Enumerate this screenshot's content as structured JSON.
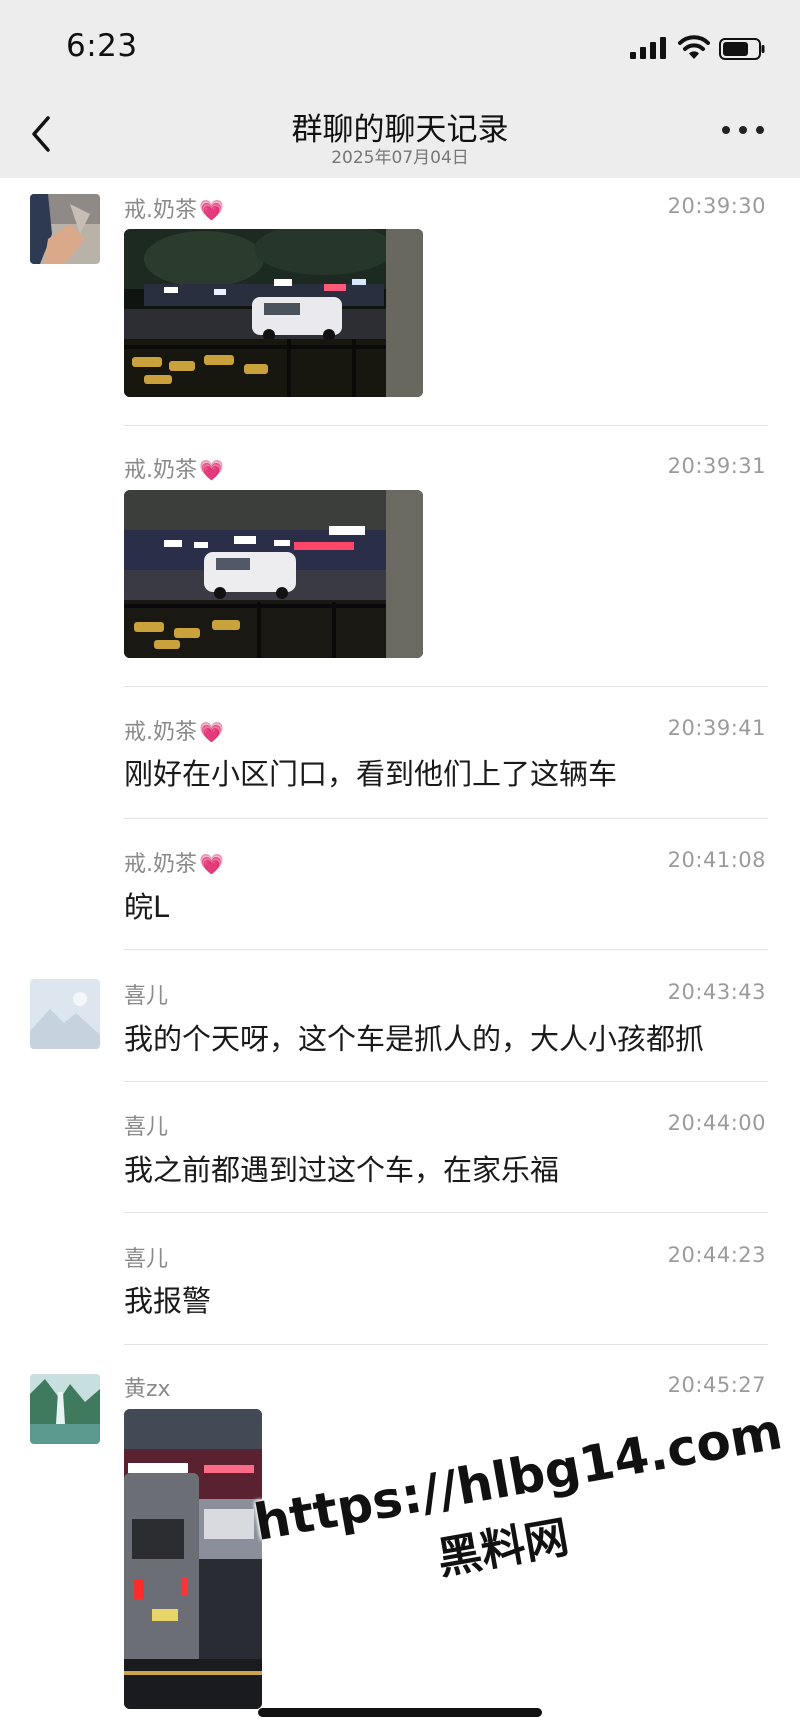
{
  "status_bar": {
    "time": "6:23"
  },
  "header": {
    "title": "群聊的聊天记录",
    "date": "2025年07月04日"
  },
  "messages": [
    {
      "sender": "戒.奶茶",
      "time": "20:39:30",
      "type": "image"
    },
    {
      "sender": "戒.奶茶",
      "time": "20:39:31",
      "type": "image"
    },
    {
      "sender": "戒.奶茶",
      "time": "20:39:41",
      "text": "刚好在小区门口，看到他们上了这辆车"
    },
    {
      "sender": "戒.奶茶",
      "time": "20:41:08",
      "text": "皖L"
    },
    {
      "sender": "喜儿",
      "time": "20:43:43",
      "text": "我的个天呀，这个车是抓人的，大人小孩都抓"
    },
    {
      "sender": "喜儿",
      "time": "20:44:00",
      "text": "我之前都遇到过这个车，在家乐福"
    },
    {
      "sender": "喜儿",
      "time": "20:44:23",
      "text": "我报警"
    },
    {
      "sender": "黄zx",
      "time": "20:45:27",
      "type": "image"
    }
  ],
  "heart_emoji": "💗",
  "watermark": {
    "url": "https://hlbg14.com",
    "name": "黑料网"
  },
  "icons": [
    "signal-icon",
    "wifi-icon",
    "battery-icon",
    "back-arrow-icon",
    "more-dots-icon"
  ]
}
